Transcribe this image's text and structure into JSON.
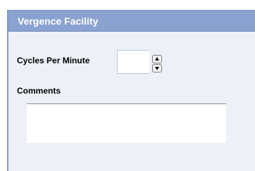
{
  "panel": {
    "title": "Vergence Facility"
  },
  "form": {
    "cycles_label": "Cycles Per Minute",
    "cycles_value": "",
    "comments_label": "Comments",
    "comments_value": ""
  },
  "icons": {
    "stepper_up": "triangle-up",
    "stepper_down": "triangle-down"
  },
  "colors": {
    "header": "#8aa2cf",
    "panel_background": "#edf0f7",
    "panel_border": "#7e97c8"
  }
}
